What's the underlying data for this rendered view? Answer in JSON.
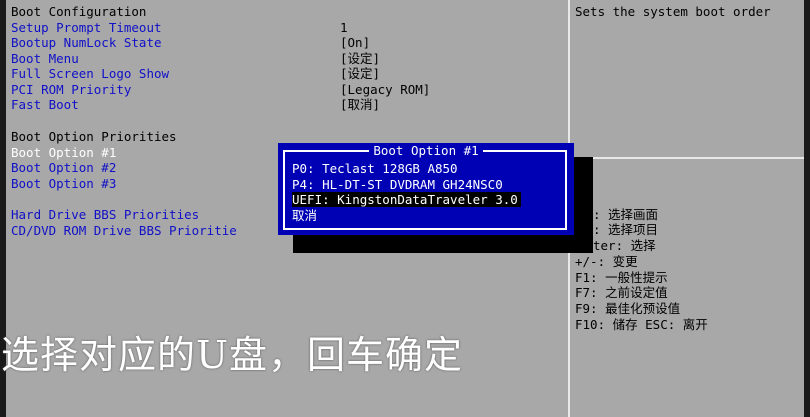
{
  "left_panel": {
    "heading": "Boot Configuration",
    "settings": [
      {
        "label": "Setup Prompt Timeout",
        "value": "1"
      },
      {
        "label": "Bootup NumLock State",
        "value": "[On]"
      },
      {
        "label": "Boot Menu",
        "value": "[设定]"
      },
      {
        "label": "Full Screen Logo Show",
        "value": "[设定]"
      },
      {
        "label": "PCI ROM Priority",
        "value": "[Legacy ROM]"
      },
      {
        "label": "Fast Boot",
        "value": "[取消]"
      }
    ],
    "priorities_heading": "Boot Option Priorities",
    "boot_options": [
      "Boot Option #1",
      "Boot Option #2",
      "Boot Option #3"
    ],
    "bbs": [
      "Hard Drive BBS Priorities",
      "CD/DVD ROM Drive BBS Prioritie"
    ]
  },
  "help_panel": {
    "text": "Sets the system boot order"
  },
  "key_legend": [
    ": 选择画面",
    ": 选择项目",
    "ter: 选择",
    "+/-: 变更",
    "F1: 一般性提示",
    "F7: 之前设定值",
    "F9: 最佳化预设值",
    "F10: 储存  ESC: 离开"
  ],
  "popup": {
    "title": "Boot Option #1",
    "options": [
      "P0: Teclast 128GB A850",
      "P4: HL-DT-ST DVDRAM GH24NSC0",
      "UEFI: KingstonDataTraveler 3.0",
      "取消"
    ],
    "selected_index": 2
  },
  "subtitle": "选择对应的U盘，回车确定",
  "colors": {
    "background": "#a8a8a8",
    "item_text": "#1010c8",
    "popup_bg": "#0000b4",
    "highlight_bg": "#000000"
  }
}
